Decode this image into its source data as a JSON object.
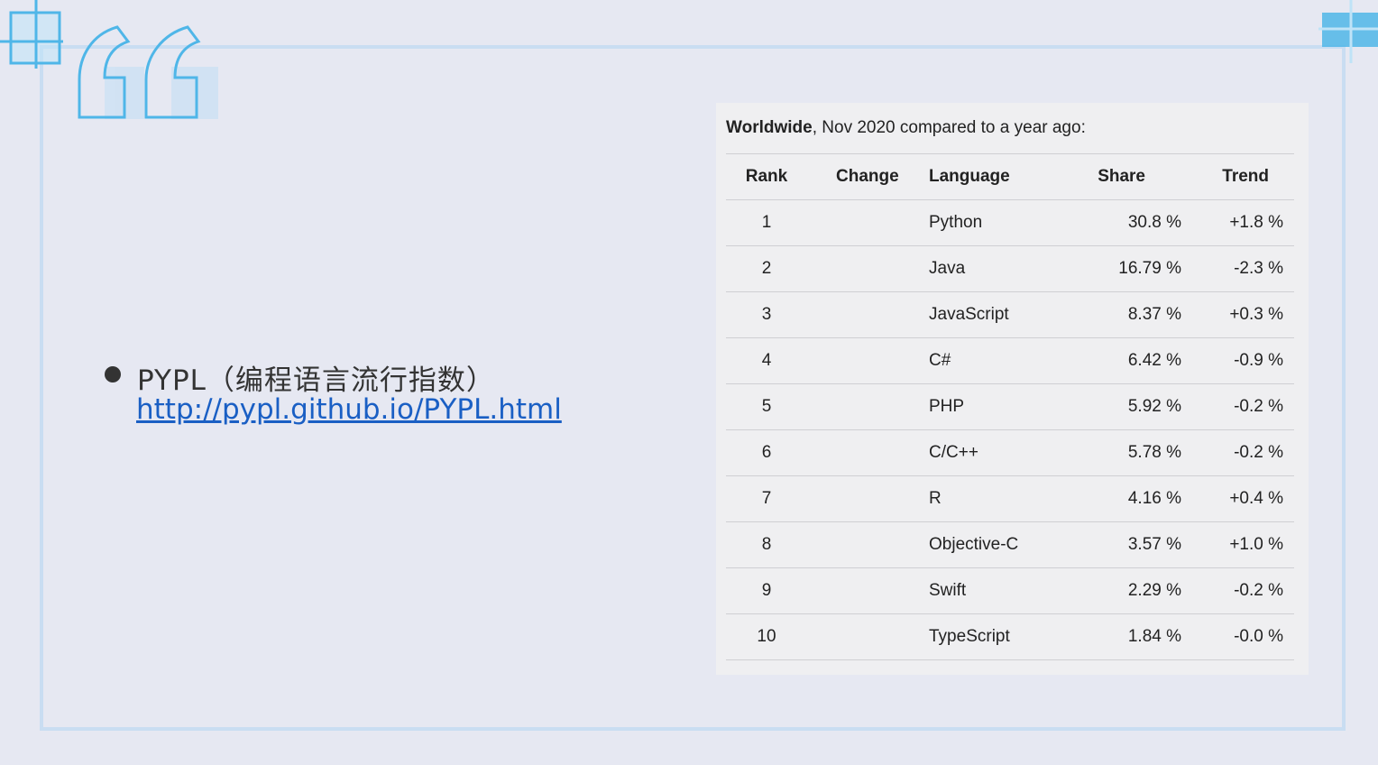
{
  "slide": {
    "bullet": {
      "title": "PYPL（编程语言流行指数）",
      "link": "http://pypl.github.io/PYPL.html"
    },
    "colors": {
      "accent": "#4fb6e8",
      "frame": "#c9ddf2",
      "link": "#1a5fc4"
    }
  },
  "table_panel": {
    "caption_bold": "Worldwide",
    "caption_rest": ", Nov 2020 compared to a year ago:",
    "headers": [
      "Rank",
      "Change",
      "Language",
      "Share",
      "Trend"
    ],
    "rows": [
      {
        "rank": "1",
        "change": "",
        "language": "Python",
        "share": "30.8 %",
        "trend": "+1.8 %"
      },
      {
        "rank": "2",
        "change": "",
        "language": "Java",
        "share": "16.79 %",
        "trend": "-2.3 %"
      },
      {
        "rank": "3",
        "change": "",
        "language": "JavaScript",
        "share": "8.37 %",
        "trend": "+0.3 %"
      },
      {
        "rank": "4",
        "change": "",
        "language": "C#",
        "share": "6.42 %",
        "trend": "-0.9 %"
      },
      {
        "rank": "5",
        "change": "",
        "language": "PHP",
        "share": "5.92 %",
        "trend": "-0.2 %"
      },
      {
        "rank": "6",
        "change": "",
        "language": "C/C++",
        "share": "5.78 %",
        "trend": "-0.2 %"
      },
      {
        "rank": "7",
        "change": "",
        "language": "R",
        "share": "4.16 %",
        "trend": "+0.4 %"
      },
      {
        "rank": "8",
        "change": "",
        "language": "Objective-C",
        "share": "3.57 %",
        "trend": "+1.0 %"
      },
      {
        "rank": "9",
        "change": "",
        "language": "Swift",
        "share": "2.29 %",
        "trend": "-0.2 %"
      },
      {
        "rank": "10",
        "change": "",
        "language": "TypeScript",
        "share": "1.84 %",
        "trend": "-0.0 %"
      }
    ]
  }
}
